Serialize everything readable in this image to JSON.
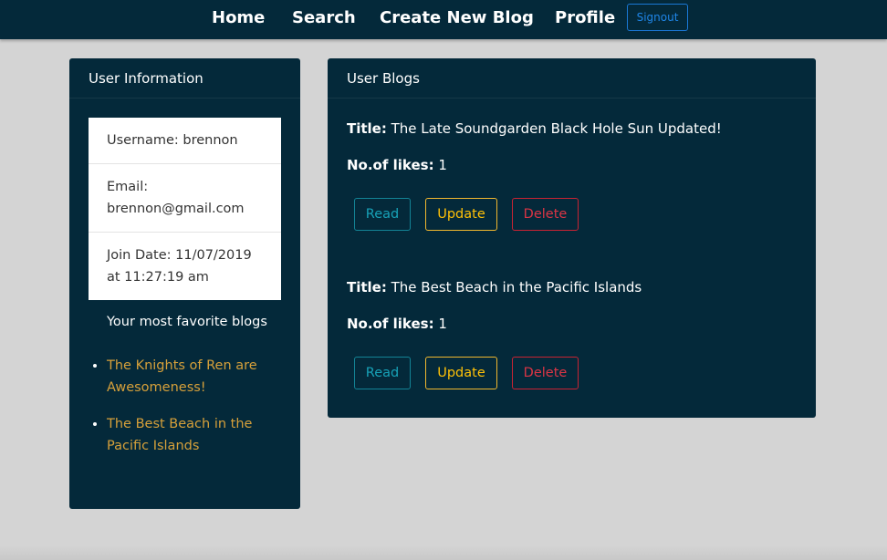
{
  "nav": {
    "links": [
      {
        "label": "Home"
      },
      {
        "label": "Search"
      },
      {
        "label": "Create New Blog"
      },
      {
        "label": "Profile"
      }
    ],
    "signout_label": "Signout"
  },
  "user_card": {
    "header": "User Information",
    "username": "Username: brennon",
    "email": "Email: brennon@gmail.com",
    "join_date": "Join Date: 11/07/2019 at 11:27:19 am",
    "favorites_title": "Your most favorite blogs",
    "favorites": [
      "The Knights of Ren are Awesomeness!",
      "The Best Beach in the Pacific Islands"
    ]
  },
  "blogs_card": {
    "header": "User Blogs",
    "title_label": "Title:",
    "likes_label": "No.of likes:",
    "buttons": {
      "read": "Read",
      "update": "Update",
      "delete": "Delete"
    },
    "blogs": [
      {
        "title": "The Late Soundgarden Black Hole Sun Updated!",
        "likes": "1"
      },
      {
        "title": "The Best Beach in the Pacific Islands",
        "likes": "1"
      }
    ]
  },
  "colors": {
    "navbar": "#04293a",
    "card": "#04293a",
    "page_background": "#d4d4d4",
    "favorite_link": "#d6a03a",
    "read": "#17a2b8",
    "update": "#ffc107",
    "delete": "#dc3545",
    "signout": "#1f86e8"
  }
}
